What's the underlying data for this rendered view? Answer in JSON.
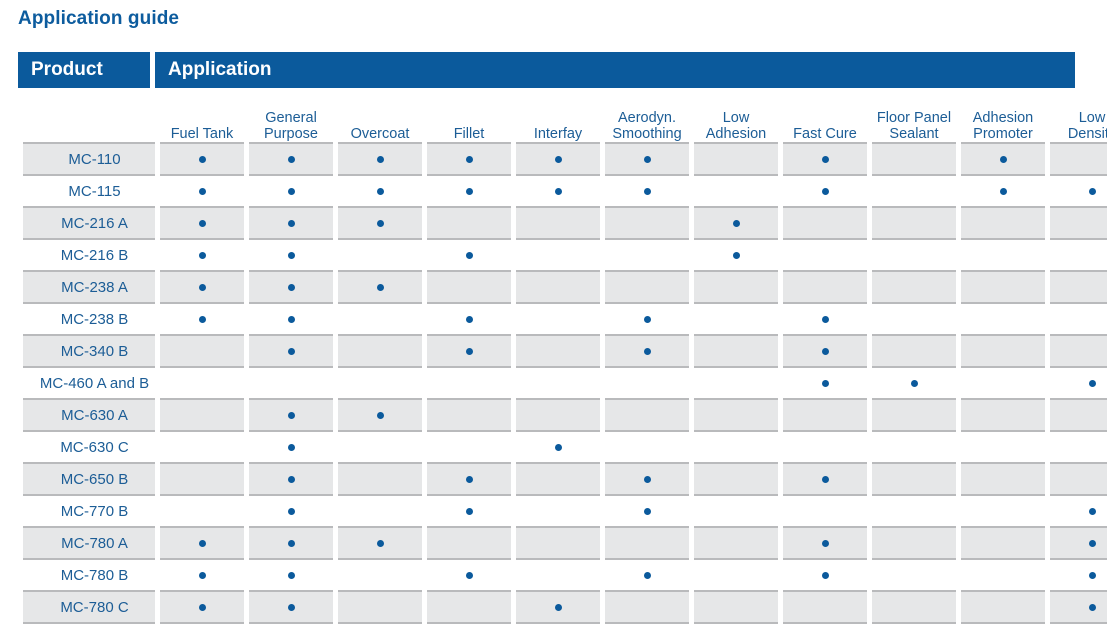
{
  "title": "Application guide",
  "colors": {
    "brand_blue": "#0b5a9c",
    "text_blue": "#1c5d96",
    "row_shade": "#e6e7e8",
    "row_border": "#b9babc",
    "dot": "#0b5a9c"
  },
  "band": {
    "product_label": "Product",
    "application_label": "Application"
  },
  "table": {
    "product_column_header": "",
    "application_columns": [
      "Fuel Tank",
      "General\nPurpose",
      "Overcoat",
      "Fillet",
      "Interfay",
      "Aerodyn.\nSmoothing",
      "Low\nAdhesion",
      "Fast Cure",
      "Floor Panel\nSealant",
      "Adhesion\nPromoter",
      "Low\nDensity"
    ],
    "rows": [
      {
        "product": "MC-110",
        "shaded": true,
        "marks": [
          1,
          1,
          1,
          1,
          1,
          1,
          0,
          1,
          0,
          1,
          0
        ]
      },
      {
        "product": "MC-115",
        "shaded": false,
        "marks": [
          1,
          1,
          1,
          1,
          1,
          1,
          0,
          1,
          0,
          1,
          1
        ]
      },
      {
        "product": "MC-216 A",
        "shaded": true,
        "marks": [
          1,
          1,
          1,
          0,
          0,
          0,
          1,
          0,
          0,
          0,
          0
        ]
      },
      {
        "product": "MC-216 B",
        "shaded": false,
        "marks": [
          1,
          1,
          0,
          1,
          0,
          0,
          1,
          0,
          0,
          0,
          0
        ]
      },
      {
        "product": "MC-238 A",
        "shaded": true,
        "marks": [
          1,
          1,
          1,
          0,
          0,
          0,
          0,
          0,
          0,
          0,
          0
        ]
      },
      {
        "product": "MC-238 B",
        "shaded": false,
        "marks": [
          1,
          1,
          0,
          1,
          0,
          1,
          0,
          1,
          0,
          0,
          0
        ]
      },
      {
        "product": "MC-340 B",
        "shaded": true,
        "marks": [
          0,
          1,
          0,
          1,
          0,
          1,
          0,
          1,
          0,
          0,
          0
        ]
      },
      {
        "product": "MC-460 A and B",
        "shaded": false,
        "marks": [
          0,
          0,
          0,
          0,
          0,
          0,
          0,
          1,
          1,
          0,
          1
        ]
      },
      {
        "product": "MC-630 A",
        "shaded": true,
        "marks": [
          0,
          1,
          1,
          0,
          0,
          0,
          0,
          0,
          0,
          0,
          0
        ]
      },
      {
        "product": "MC-630 C",
        "shaded": false,
        "marks": [
          0,
          1,
          0,
          0,
          1,
          0,
          0,
          0,
          0,
          0,
          0
        ]
      },
      {
        "product": "MC-650 B",
        "shaded": true,
        "marks": [
          0,
          1,
          0,
          1,
          0,
          1,
          0,
          1,
          0,
          0,
          0
        ]
      },
      {
        "product": "MC-770 B",
        "shaded": false,
        "marks": [
          0,
          1,
          0,
          1,
          0,
          1,
          0,
          0,
          0,
          0,
          1
        ]
      },
      {
        "product": "MC-780 A",
        "shaded": true,
        "marks": [
          1,
          1,
          1,
          0,
          0,
          0,
          0,
          1,
          0,
          0,
          1
        ]
      },
      {
        "product": "MC-780 B",
        "shaded": false,
        "marks": [
          1,
          1,
          0,
          1,
          0,
          1,
          0,
          1,
          0,
          0,
          1
        ]
      },
      {
        "product": "MC-780 C",
        "shaded": true,
        "marks": [
          1,
          1,
          0,
          0,
          1,
          0,
          0,
          0,
          0,
          0,
          1
        ]
      }
    ]
  }
}
